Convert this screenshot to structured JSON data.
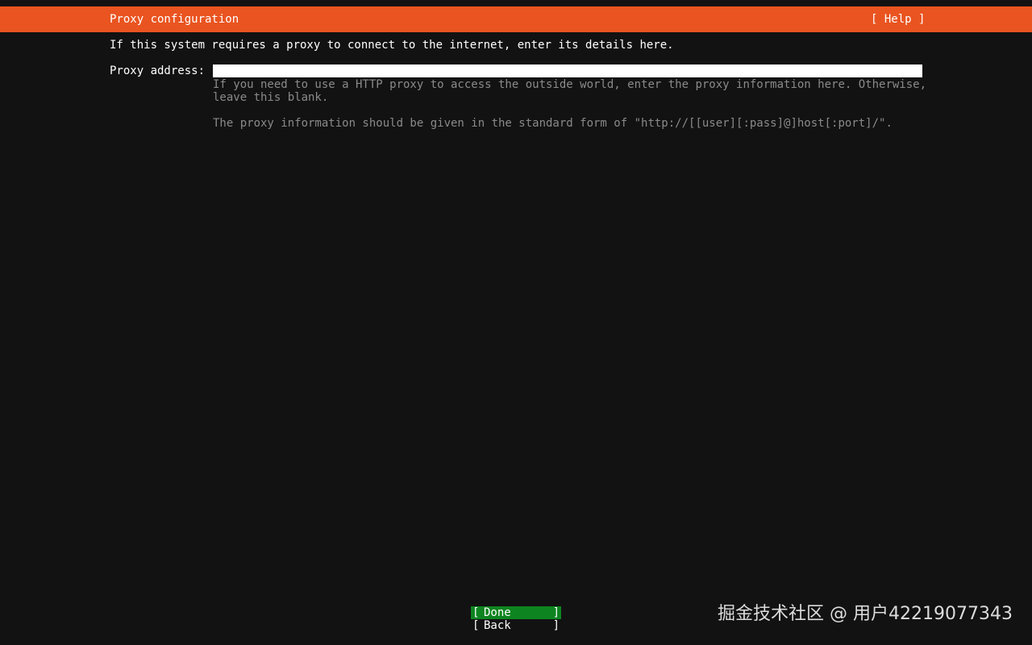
{
  "header": {
    "title": "Proxy configuration",
    "help_label": "[ Help ]"
  },
  "main": {
    "intro": "If this system requires a proxy to connect to the internet, enter its details here.",
    "proxy_field": {
      "label": "Proxy address:",
      "value": "",
      "help_line1": "If you need to use a HTTP proxy to access the outside world, enter the proxy information here. Otherwise,",
      "help_line2": "leave this blank.",
      "help_line3": "The proxy information should be given in the standard form of \"http://[[user][:pass]@]host[:port]/\"."
    }
  },
  "buttons": {
    "done": {
      "open": "[",
      "label": "Done",
      "close": "]"
    },
    "back": {
      "open": "[",
      "label": "Back",
      "close": "]"
    }
  },
  "watermark": "掘金技术社区 @ 用户42219077343",
  "colors": {
    "background": "#121212",
    "title_bar": "#e95420",
    "focus_button": "#0e8420",
    "help_text": "#8a8a8a"
  }
}
